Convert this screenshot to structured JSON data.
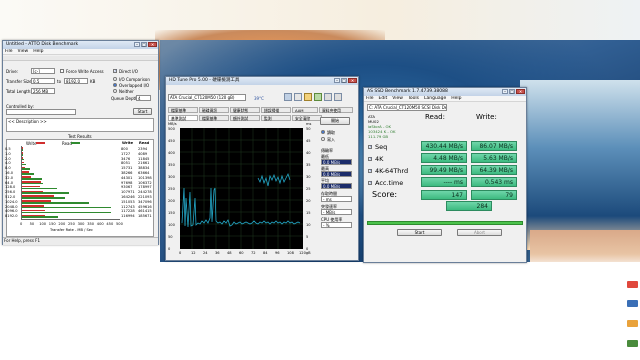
{
  "atto": {
    "title": "Untitled - ATTO Disk Benchmark",
    "menu": [
      "File",
      "View",
      "Help"
    ],
    "drive_label": "Drive:",
    "drive_value": "[c-]",
    "force_write_access": "Force Write Access",
    "direct_io": "Direct I/O",
    "transfer_size_label": "Transfer Size:",
    "transfer_from": "0.5",
    "transfer_to_word": "to",
    "transfer_to": "8192.0",
    "transfer_unit": "KB",
    "io_comparison": "I/O Comparison",
    "overlapped_io": "Overlapped I/O",
    "neither": "Neither",
    "total_length_label": "Total Length:",
    "total_length": "256 MB",
    "queue_depth_label": "Queue Depth:",
    "queue_depth": "4",
    "controlled_by": "Controlled by:",
    "start_button": "Start",
    "description": "<< Description >>",
    "results_title": "Test Results",
    "legend_write": "Write",
    "legend_read": "Read",
    "col_write": "Write",
    "col_read": "Read",
    "rows": [
      {
        "size": "0.5",
        "write": "800",
        "read": "2394"
      },
      {
        "size": "1.0",
        "write": "1727",
        "read": "4089"
      },
      {
        "size": "2.0",
        "write": "3476",
        "read": "11845"
      },
      {
        "size": "4.0",
        "write": "8051",
        "read": "21661"
      },
      {
        "size": "8.0",
        "write": "15731",
        "read": "38834"
      },
      {
        "size": "16.0",
        "write": "38266",
        "read": "63664"
      },
      {
        "size": "32.0",
        "write": "44301",
        "read": "101398"
      },
      {
        "size": "64.0",
        "write": "97698",
        "read": "106372"
      },
      {
        "size": "128.0",
        "write": "93067",
        "read": "178997"
      },
      {
        "size": "256.0",
        "write": "107971",
        "read": "244278"
      },
      {
        "size": "512.0",
        "write": "164246",
        "read": "221093"
      },
      {
        "size": "1024.0",
        "write": "151053",
        "read": "347096"
      },
      {
        "size": "2048.0",
        "write": "112743",
        "read": "459616"
      },
      {
        "size": "4096.0",
        "write": "117228",
        "read": "461415"
      },
      {
        "size": "8192.0",
        "write": "116994",
        "read": "185671"
      }
    ],
    "xaxis_ticks": [
      "0",
      "50",
      "100",
      "150",
      "200",
      "250",
      "300",
      "350",
      "400",
      "450",
      "500"
    ],
    "xaxis_caption": "Transfer Rate - MB / Sec",
    "status": "For Help, press F1"
  },
  "hdtune": {
    "title": "HD Tune Pro 5.00 - 硬碟檢測工具",
    "drive": "ATA  Crucial_CT120M50 (120 gB)",
    "temp": "39°C",
    "tabs": [
      "檔案基準",
      "磁碟資訊",
      "健康狀態",
      "錯誤掃描",
      "AAM",
      "資料夾使用"
    ],
    "tabs2": [
      "基準測試",
      "檔案基準",
      "額外測試",
      "監測",
      "安全清除"
    ],
    "y_left_ticks": [
      "500",
      "450",
      "400",
      "350",
      "300",
      "250",
      "200",
      "150",
      "100",
      "50",
      "0"
    ],
    "y_right_ticks": [
      "50",
      "45",
      "40",
      "35",
      "30",
      "25",
      "20",
      "15",
      "10",
      "5",
      "0"
    ],
    "y_left_unit": "MB/s",
    "y_right_unit": "ms",
    "x_ticks": [
      "0",
      "12",
      "24",
      "36",
      "48",
      "60",
      "72",
      "84",
      "96",
      "108",
      "120gB"
    ],
    "start_button": "開始",
    "options": [
      "讀取",
      "寫入"
    ],
    "stats": [
      "傳輸率",
      "最低",
      "最高",
      "平均",
      "存取時間",
      "突發速率",
      "CPU 使用率"
    ],
    "stats_values": [
      "0.0 MB/s",
      "0.0 MB/s",
      "0.0 MB/s",
      "- ms",
      "- MB/s",
      "- %"
    ]
  },
  "asssd": {
    "title": "AS SSD Benchmark 1.7.4739.38088",
    "menu": [
      "File",
      "Edit",
      "View",
      "Tools",
      "Language",
      "Help"
    ],
    "drive": "C: ATA Crucial_CT120M50 SCSI Disk Device",
    "info_lines": [
      "ATA",
      "MU02",
      "iaStorA - OK",
      "103424 K - OK",
      "111.79 GB"
    ],
    "col_read": "Read:",
    "col_write": "Write:",
    "tests": [
      {
        "name": "Seq",
        "read": "430.44 MB/s",
        "write": "86.07 MB/s"
      },
      {
        "name": "4K",
        "read": "4.48 MB/s",
        "write": "5.63 MB/s"
      },
      {
        "name": "4K-64Thrd",
        "read": "99.49 MB/s",
        "write": "64.39 MB/s"
      },
      {
        "name": "Acc.time",
        "read": "---- ms",
        "write": "0.543 ms"
      }
    ],
    "score_label": "Score:",
    "score_read": "147",
    "score_write": "79",
    "score_total": "284",
    "start_button": "Start",
    "abort_button": "Abort"
  }
}
